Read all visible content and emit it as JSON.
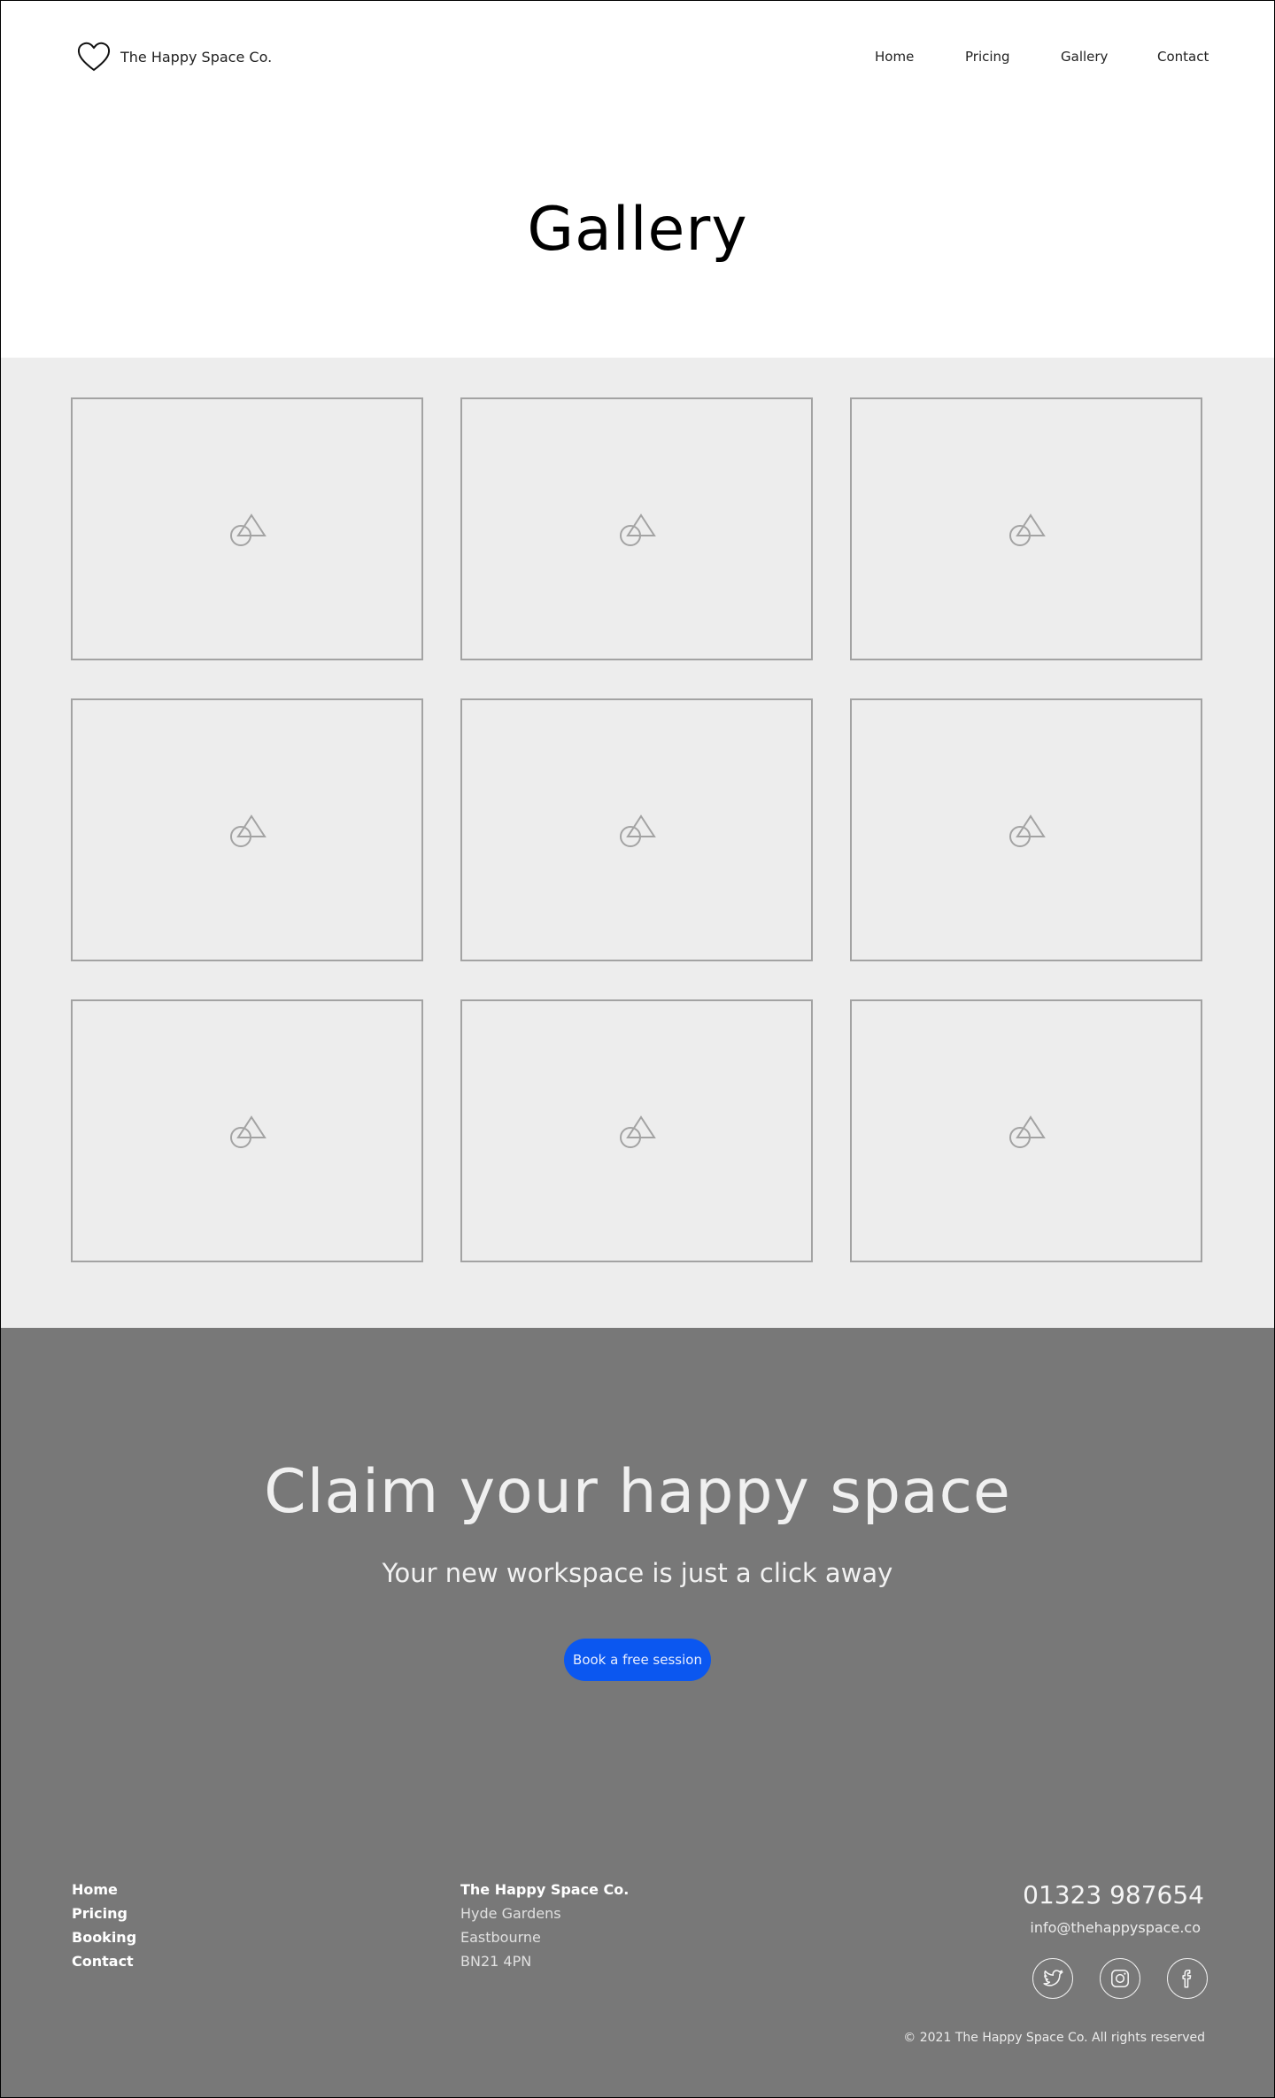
{
  "brand": {
    "name": "The Happy Space Co."
  },
  "nav": {
    "items": [
      "Home",
      "Pricing",
      "Gallery",
      "Contact"
    ]
  },
  "page": {
    "title": "Gallery"
  },
  "gallery": {
    "placeholder_icon": "image-placeholder-icon",
    "tile_count": 9
  },
  "cta": {
    "title": "Claim your happy space",
    "subtitle": "Your new workspace is just a click away",
    "button_label": "Book a free session",
    "button_color": "#0b57f0"
  },
  "footer": {
    "links": [
      "Home",
      "Pricing",
      "Booking",
      "Contact"
    ],
    "address": {
      "name": "The Happy Space Co.",
      "line1": "Hyde Gardens",
      "line2": "Eastbourne",
      "line3": "BN21 4PN"
    },
    "phone": "01323 987654",
    "email": "info@thehappyspace.co",
    "socials": [
      "twitter-icon",
      "instagram-icon",
      "facebook-icon"
    ],
    "copyright": "© 2021 The Happy Space Co. All rights reserved"
  },
  "colors": {
    "gallery_bg": "#ededed",
    "cta_bg": "#787878",
    "tile_border": "#a3a3a3"
  }
}
